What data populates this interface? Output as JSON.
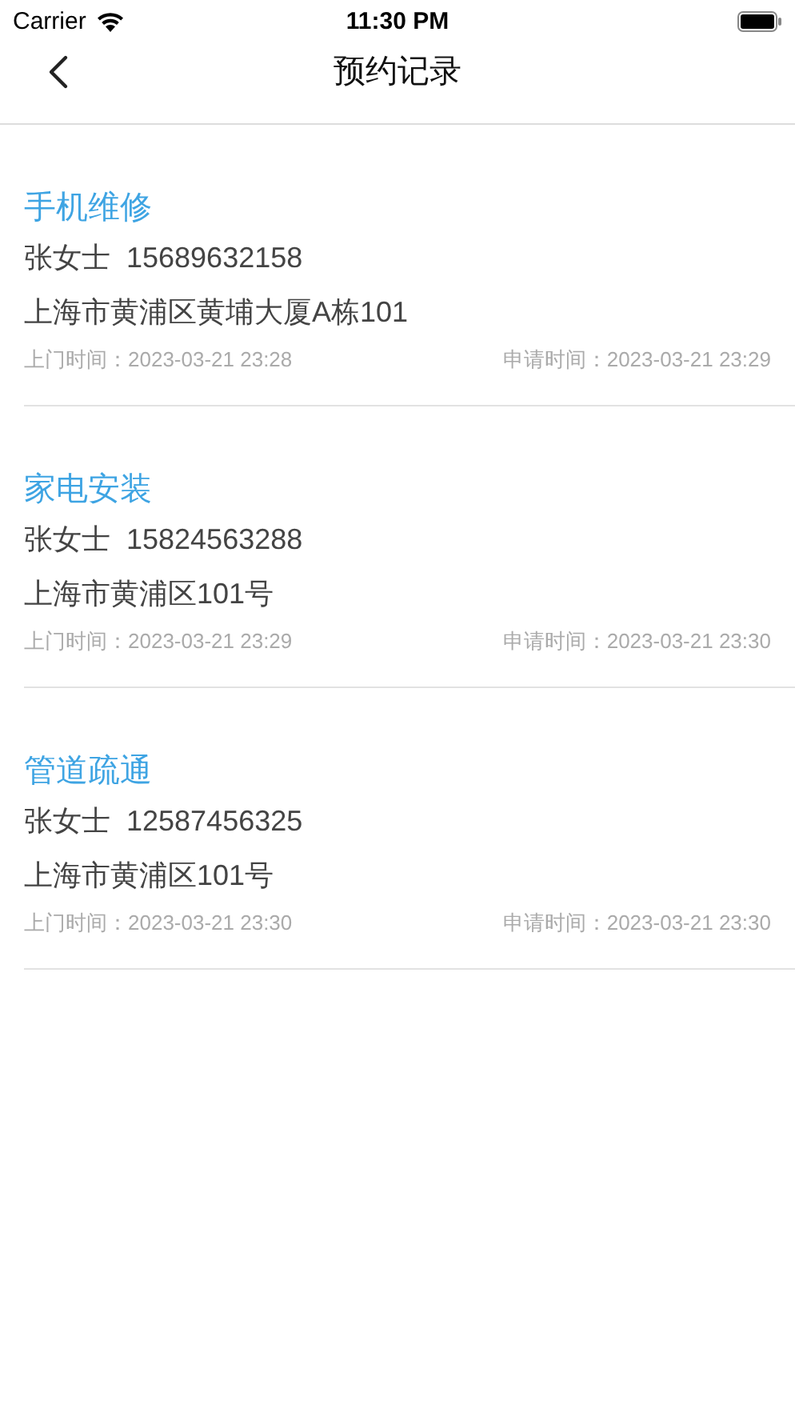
{
  "status_bar": {
    "carrier": "Carrier",
    "time": "11:30 PM"
  },
  "nav": {
    "title": "预约记录"
  },
  "records": [
    {
      "service": "手机维修",
      "name": "张女士",
      "phone": "15689632158",
      "address": "上海市黄浦区黄埔大厦A栋101",
      "visit_time": "上门时间：2023-03-21 23:28",
      "apply_time": "申请时间：2023-03-21 23:29"
    },
    {
      "service": "家电安装",
      "name": "张女士",
      "phone": "15824563288",
      "address": "上海市黄浦区101号",
      "visit_time": "上门时间：2023-03-21 23:29",
      "apply_time": "申请时间：2023-03-21 23:30"
    },
    {
      "service": "管道疏通",
      "name": "张女士",
      "phone": "12587456325",
      "address": "上海市黄浦区101号",
      "visit_time": "上门时间：2023-03-21 23:30",
      "apply_time": "申请时间：2023-03-21 23:30"
    }
  ]
}
